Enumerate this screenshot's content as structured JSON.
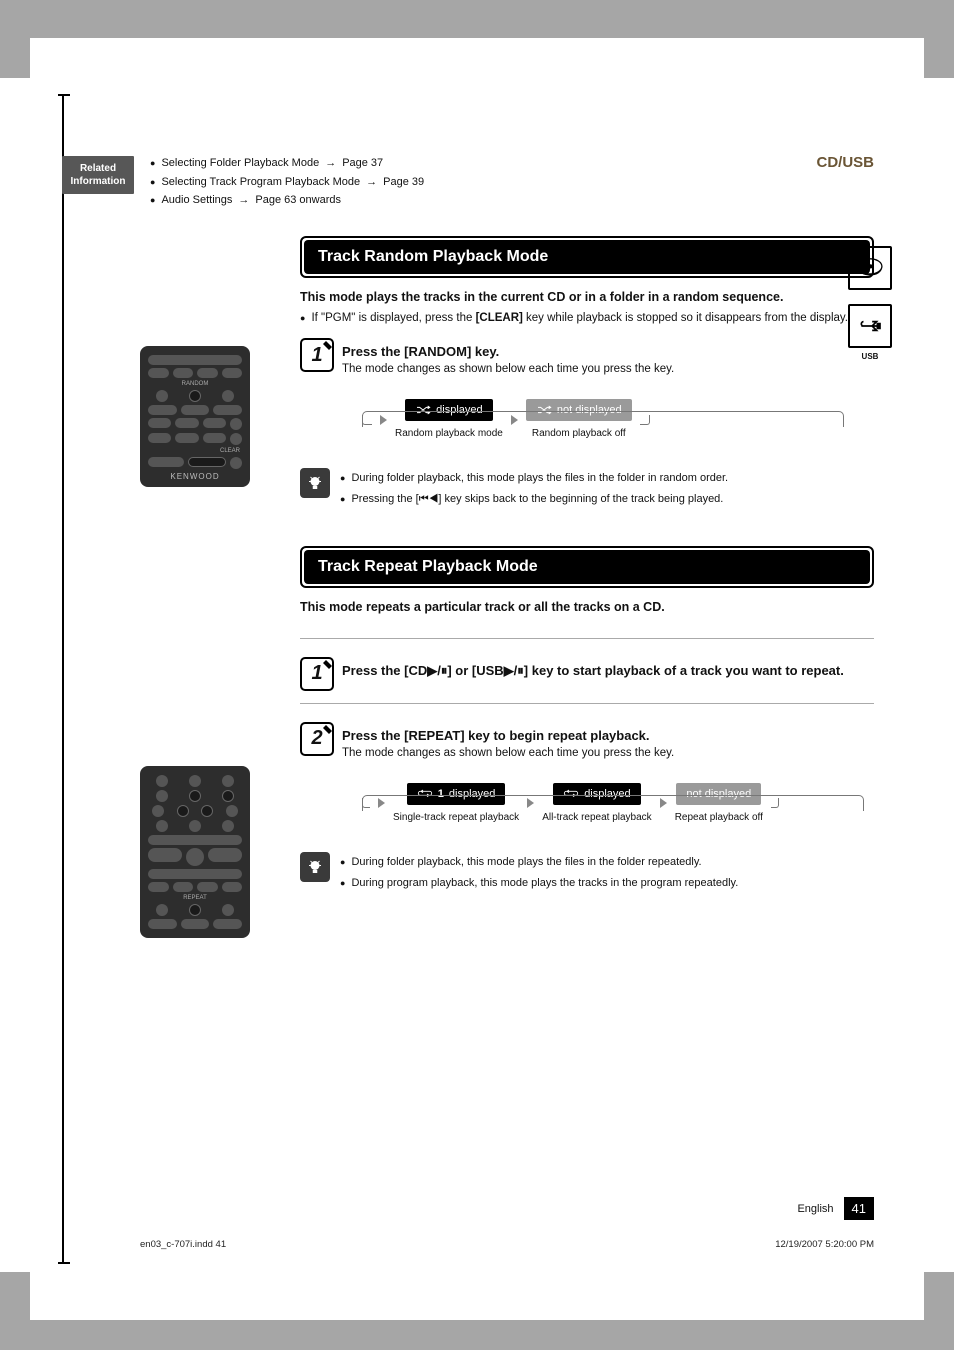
{
  "header": {
    "category": "CD/USB"
  },
  "related": {
    "tag_line1": "Related",
    "tag_line2": "Information",
    "items": [
      {
        "text": "Selecting Folder Playback Mode",
        "ref": "Page 37"
      },
      {
        "text": "Selecting Track Program Playback Mode",
        "ref": "Page 39"
      },
      {
        "text": "Audio Settings",
        "ref": "Page 63 onwards"
      }
    ]
  },
  "usb_label": "USB",
  "random": {
    "title": "Track Random Playback Mode",
    "intro": "This mode plays the tracks in the current CD or in a folder in a random sequence.",
    "note_prefix": "If \"PGM\" is displayed, press the ",
    "note_key": "[CLEAR]",
    "note_suffix": " key while playback is stopped so it disappears from the display.",
    "step1_title": "Press the [RANDOM] key.",
    "step1_sub": "The mode changes as shown below each time you press the key.",
    "mode_on": "displayed",
    "mode_on_cap": "Random playback mode",
    "mode_off": "not displayed",
    "mode_off_cap": "Random playback off",
    "tips": [
      "During folder playback, this mode plays the files in the folder in random order.",
      "Pressing the [⏮◀] key skips back to the beginning of the track being played."
    ]
  },
  "repeat": {
    "title": "Track Repeat Playback Mode",
    "intro": "This mode repeats a particular track or all the tracks on a CD.",
    "step1_title": "Press the [CD▶/⏸] or [USB▶/⏸] key to start playback of a track you want to repeat.",
    "step2_title": "Press the [REPEAT] key to begin repeat playback.",
    "step2_sub": "The mode changes as shown below each time you press the key.",
    "m1": "displayed",
    "m1_cap": "Single-track repeat playback",
    "m1_badge": "1",
    "m2": "displayed",
    "m2_cap": "All-track repeat playback",
    "m3": "not displayed",
    "m3_cap": "Repeat playback off",
    "tips": [
      "During folder playback, this mode plays the files in the folder repeatedly.",
      "During program playback, this mode plays the tracks in the program repeatedly."
    ]
  },
  "remote": {
    "random_label": "RANDOM",
    "repeat_label": "REPEAT",
    "clear_label": "CLEAR",
    "brand": "KENWOOD"
  },
  "footer": {
    "lang": "English",
    "page": "41",
    "file": "en03_c-707i.indd   41",
    "stamp": "12/19/2007   5:20:00 PM"
  }
}
